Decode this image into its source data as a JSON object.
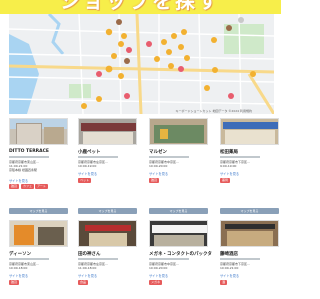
{
  "header": {
    "title": "ショップを探す"
  },
  "map": {
    "attribution": "キーボードショートカット  地図データ ©2024  利用規約",
    "bg": "#eef0f2",
    "water": "#a9d4f2",
    "park": "#cfe9c9",
    "road_major": "#f8d98a",
    "marker_colors": [
      "#f2b131",
      "#e85d6e",
      "#9b6b4a",
      "#c9c9c9"
    ]
  },
  "shops": [
    {
      "name": "DITTO TERRACE",
      "address": "京都府京都市東山区...",
      "hours": "11:00-21:00",
      "line": "京阪本線 祇園四条駅",
      "tags": [
        "雑貨",
        "カフェ",
        "アート"
      ],
      "link": "サイトを見る"
    },
    {
      "name": "小鹿ペット",
      "address": "京都府京都市左京区...",
      "hours": "10:00-19:00",
      "tags": [
        "ペット"
      ],
      "link": "サイトを見る"
    },
    {
      "name": "マルゼン",
      "address": "京都府京都市中京区...",
      "hours": "10:00-20:00",
      "tags": [
        "雑貨"
      ],
      "link": "サイトを見る"
    },
    {
      "name": "松田薬局",
      "address": "京都府京都市下京区...",
      "hours": "9:00-19:00",
      "tags": [
        "薬局"
      ],
      "link": "サイトを見る"
    },
    {
      "name": "ディーソン",
      "address": "京都府京都市東山区...",
      "hours": "10:00-18:00",
      "tags": [
        "雑貨"
      ],
      "link": "サイトを見る"
    },
    {
      "name": "田の神さん",
      "address": "京都府京都市左京区...",
      "hours": "11:00-18:00",
      "tags": [
        "食品"
      ],
      "link": "サイトを見る"
    },
    {
      "name": "メガネ・コンタクトのパックタ",
      "address": "京都府京都市中京区...",
      "hours": "10:00-20:00",
      "tags": [
        "メガネ"
      ],
      "link": "サイトを見る"
    },
    {
      "name": "藤崎酒店",
      "address": "京都府京都市下京区...",
      "hours": "10:00-21:00",
      "tags": [
        "酒"
      ],
      "link": "サイトを見る"
    }
  ],
  "map_button_label": "マップを見る",
  "tag_colors": {
    "primary": "#e65b5b",
    "secondary": "#f08a6a"
  }
}
